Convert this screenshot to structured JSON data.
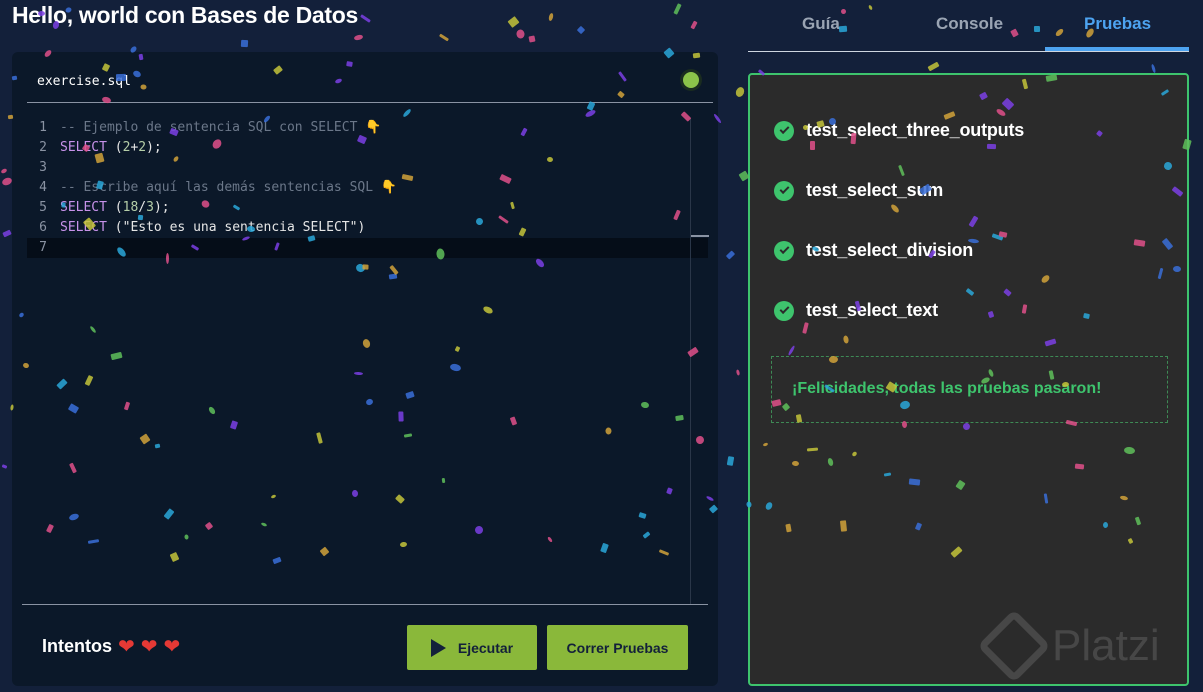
{
  "page": {
    "title": "Hello, world con Bases de Datos"
  },
  "editor": {
    "file_name": "exercise.sql",
    "lines": [
      {
        "num": "1",
        "parts": [
          [
            "comment",
            "-- Ejemplo de sentencia SQL con SELECT 👇"
          ]
        ]
      },
      {
        "num": "2",
        "parts": [
          [
            "kw",
            "SELECT"
          ],
          [
            "plain",
            " ("
          ],
          [
            "num",
            "2"
          ],
          [
            "plain",
            "+"
          ],
          [
            "num",
            "2"
          ],
          [
            "plain",
            ");"
          ]
        ]
      },
      {
        "num": "3",
        "parts": []
      },
      {
        "num": "4",
        "parts": [
          [
            "comment",
            "-- Escribe aquí las demás sentencias SQL 👇"
          ]
        ]
      },
      {
        "num": "5",
        "parts": [
          [
            "kw",
            "SELECT"
          ],
          [
            "plain",
            " ("
          ],
          [
            "num",
            "18"
          ],
          [
            "plain",
            "/"
          ],
          [
            "num",
            "3"
          ],
          [
            "plain",
            ");"
          ]
        ]
      },
      {
        "num": "6",
        "parts": [
          [
            "kw",
            "SELECT"
          ],
          [
            "plain",
            " ("
          ],
          [
            "str",
            "\"Esto es una sentencia SELECT\""
          ],
          [
            "plain",
            ")"
          ]
        ]
      },
      {
        "num": "7",
        "parts": [],
        "active": true
      }
    ]
  },
  "footer": {
    "attempts_label": "Intentos",
    "hearts": [
      "❤",
      "❤",
      "❤"
    ],
    "run_label": "Ejecutar",
    "tests_label": "Correr Pruebas"
  },
  "tabs": {
    "guia": "Guía",
    "console": "Console",
    "pruebas": "Pruebas",
    "active": "pruebas"
  },
  "tests": {
    "items": [
      {
        "name": "test_select_three_outputs",
        "status": "passed"
      },
      {
        "name": "test_select_sum",
        "status": "passed"
      },
      {
        "name": "test_select_division",
        "status": "passed"
      },
      {
        "name": "test_select_text",
        "status": "passed"
      }
    ],
    "success_message": "¡Felicidades, todas las pruebas pasaron!"
  },
  "branding": {
    "watermark": "Platzi"
  },
  "colors": {
    "accent_blue": "#4da3f0",
    "success_green": "#3ec46d",
    "button_green": "#8ab83a",
    "heart_red": "#e53935"
  }
}
